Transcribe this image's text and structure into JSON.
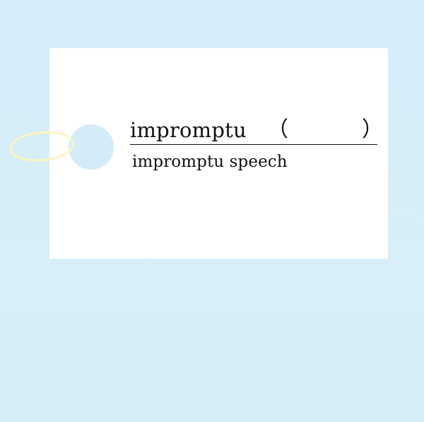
{
  "card": {
    "word": "impromptu",
    "left_paren": "（",
    "answer": "",
    "right_paren": "）",
    "example": "impromptu speech"
  }
}
